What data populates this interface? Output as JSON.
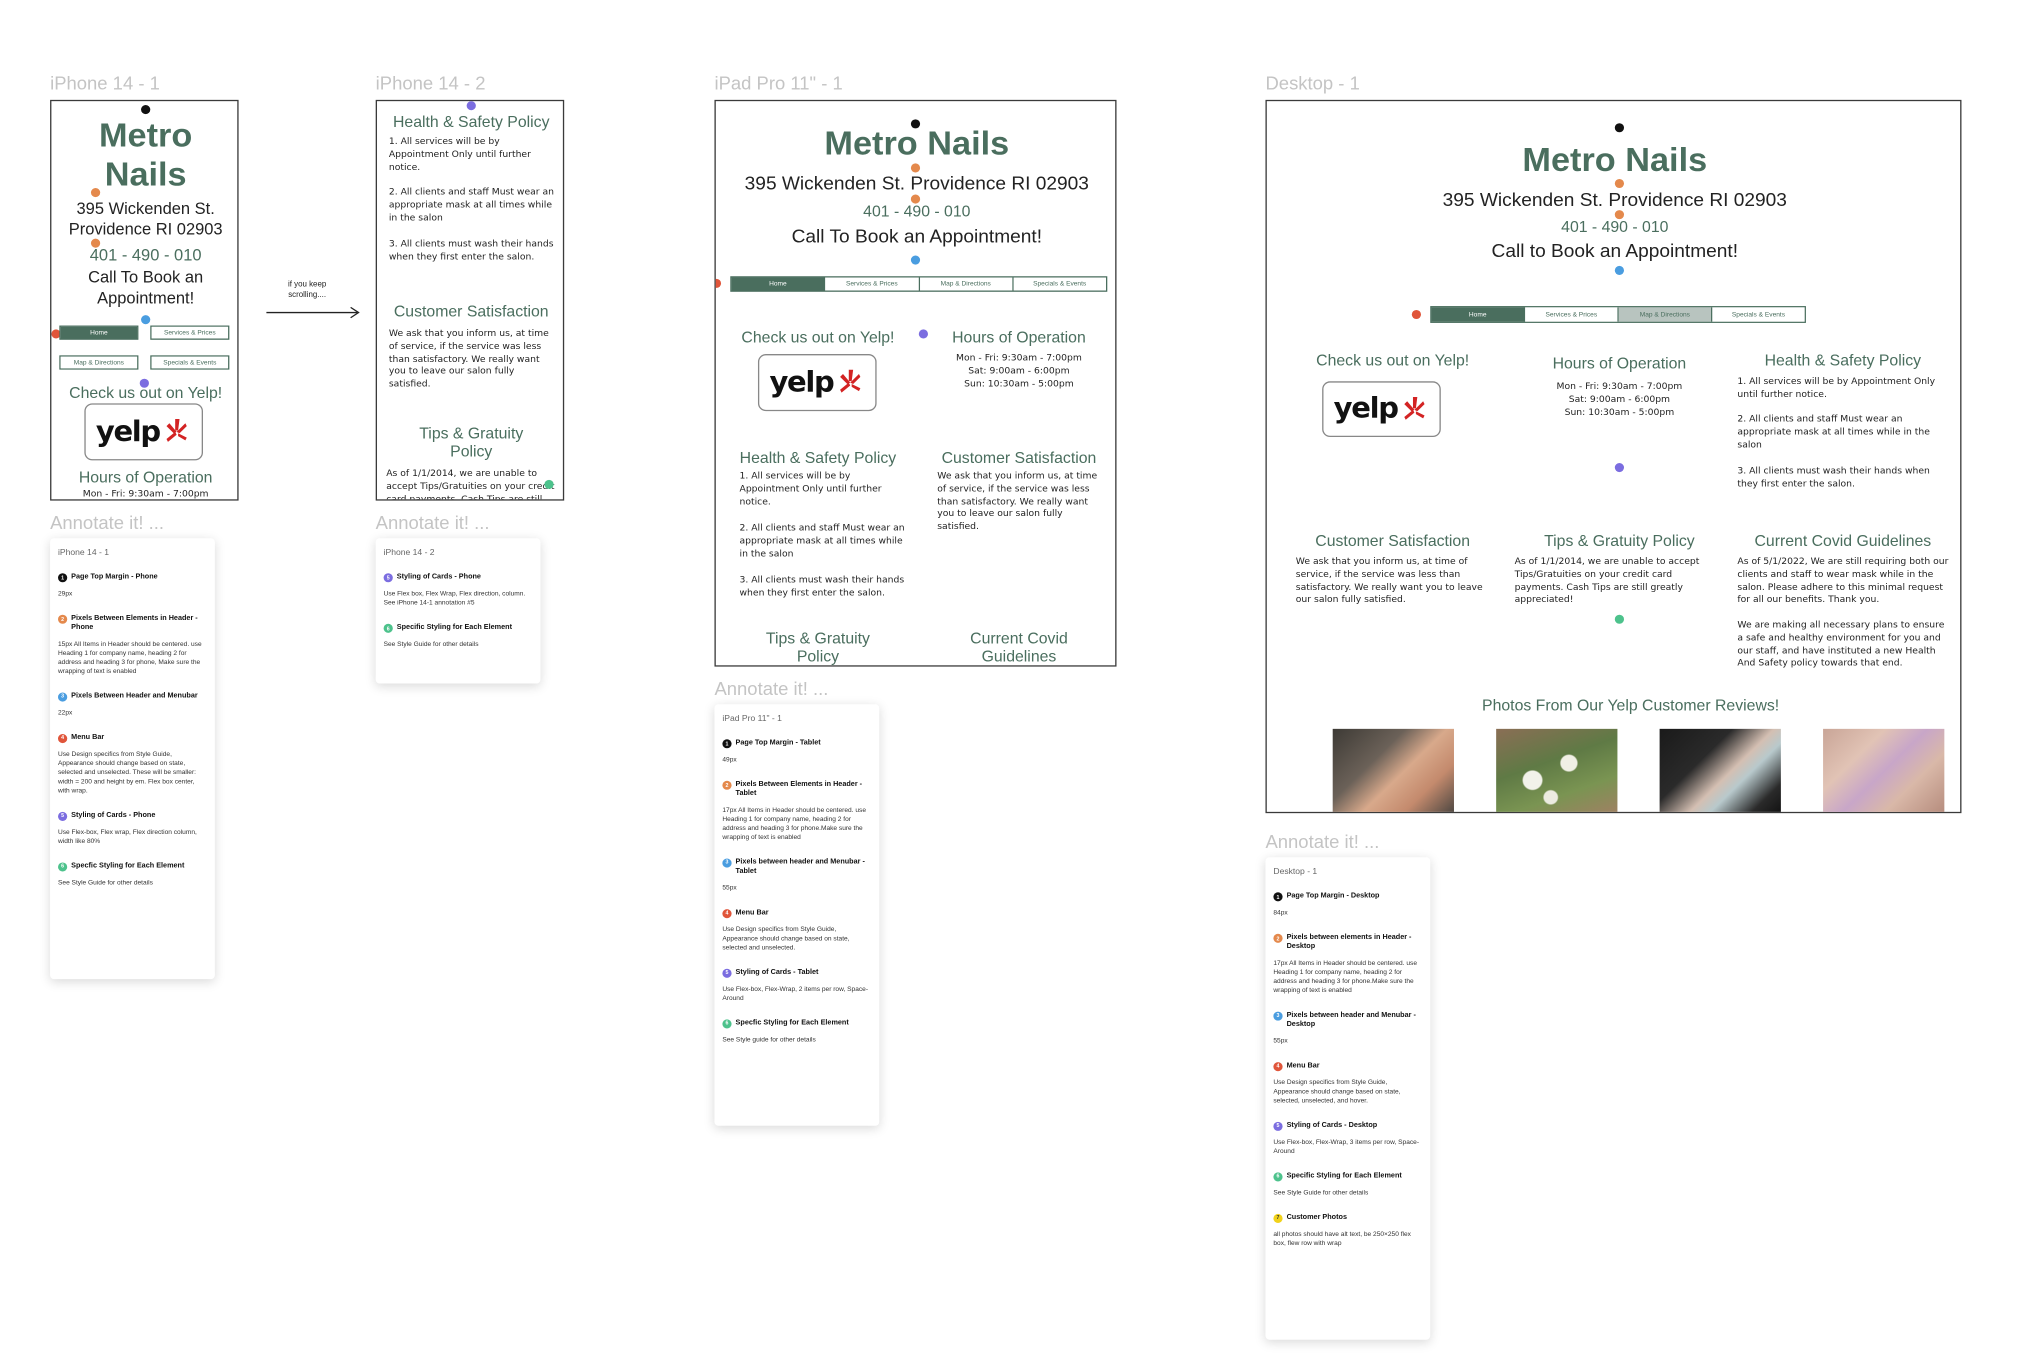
{
  "frames": {
    "iphone1": "iPhone 14 - 1",
    "iphone2": "iPhone 14 - 2",
    "ipad": "iPad Pro 11\" - 1",
    "desktop": "Desktop - 1"
  },
  "annotate_label": "Annotate it! ...",
  "site": {
    "name_line1": "Metro",
    "name_line2": "Nails",
    "name": "Metro Nails",
    "address": "395 Wickenden St. Providence RI 02903",
    "address_line1": "395 Wickenden St.",
    "address_line2": "Providence RI 02903",
    "phone": "401 - 490 - 010",
    "cta_upper": "Call To Book an Appointment!",
    "cta_lower": "Call to Book an Appointment!",
    "cta_line1": "Call To Book an",
    "cta_line2": "Appointment!",
    "menu": [
      "Home",
      "Services & Prices",
      "Map & Directions",
      "Specials & Events"
    ],
    "yelp_title": "Check us out on Yelp!",
    "yelp_word": "yelp",
    "hours_title": "Hours of Operation",
    "hours": [
      "Mon - Fri:   9:30am - 7:00pm",
      "Sat:   9:00am - 6:00pm",
      "Sun:  10:30am - 5:00pm"
    ],
    "hs_title": "Health & Safety Policy",
    "hs_items": [
      "1.  All services will be by Appointment Only until further notice.",
      "2.  All clients and staff Must wear an appropriate mask at all times while in the salon",
      "3.  All clients must wash their hands  when they first enter the salon."
    ],
    "cs_title": "Customer Satisfaction",
    "cs_text": "We ask that you  inform us, at time of service, if the service was less than satisfactory. We really want you to leave our salon fully satisfied.",
    "tips_title": "Tips & Gratuity Policy",
    "tips_text": "As of 1/1/2014, we are unable to accept Tips/Gratuities on your credit card payments.  Cash Tips are still greatly appreciated!",
    "covid_title": "Current Covid Guidelines",
    "covid_text1": "As of 5/1/2022, We are still requiring both our clients and staff to wear mask while in the salon. Please adhere to this minimal request for all our benefits. Thank you.",
    "covid_text2": "We are making all necessary plans to ensure a safe and healthy environment for you and our staff, and have instituted a new Health And Safety policy towards that end.",
    "photos_title": "Photos From Our Yelp Customer Reviews!"
  },
  "scroll_note": "if you keep scrolling....",
  "panels": {
    "iphone1": {
      "title": "iPhone 14 - 1",
      "items": [
        {
          "n": "1",
          "h": "Page Top Margin - Phone",
          "b": "29px"
        },
        {
          "n": "2",
          "h": "Pixels Between Elements in Header - Phone",
          "b": "15px All Items in Header should be centered. use Heading 1 for company name, heading 2 for address and heading 3 for phone, Make sure the wrapping of text is enabled"
        },
        {
          "n": "3",
          "h": "Pixels Between Header and Menubar",
          "b": "22px"
        },
        {
          "n": "4",
          "h": "Menu Bar",
          "b": "Use Design specifics from Style Guide, Appearance should change based on state, selected and unselected. These will be smaller: width = 200 and height by em. Flex box center, with wrap."
        },
        {
          "n": "5",
          "h": "Styling of Cards - Phone",
          "b": "Use Flex-box, Flex wrap, Flex direction column, width like 80%"
        },
        {
          "n": "6",
          "h": "Specfic Styling for Each Element",
          "b": "See Style Guide for other details"
        }
      ]
    },
    "iphone2": {
      "title": "iPhone 14 - 2",
      "items": [
        {
          "n": "5",
          "h": "Styling of Cards - Phone",
          "b": "Use Flex box, Flex Wrap, Flex direction, column. See iPhone 14-1 annotation #5"
        },
        {
          "n": "6",
          "h": "Specific Styling for Each Element",
          "b": "See Style Guide for other details"
        }
      ]
    },
    "ipad": {
      "title": "iPad Pro 11\" - 1",
      "items": [
        {
          "n": "1",
          "h": "Page Top Margin - Tablet",
          "b": "49px"
        },
        {
          "n": "2",
          "h": "Pixels Between Elements in Header - Tablet",
          "b": "17px All Items in Header should be centered. use Heading 1 for company name, heading 2 for address and heading 3 for phone.Make sure the wrapping of text is enabled"
        },
        {
          "n": "3",
          "h": "Pixels between header and Menubar - Tablet",
          "b": "55px"
        },
        {
          "n": "4",
          "h": "Menu Bar",
          "b": "Use Design specifics from Style Guide, Appearance should change based on state, selected and unselected."
        },
        {
          "n": "5",
          "h": "Styling of Cards - Tablet",
          "b": "Use Flex-box, Flex-Wrap, 2 items per row, Space-Around"
        },
        {
          "n": "6",
          "h": "Specfic Styling for Each Element",
          "b": "See Style guide for other details"
        }
      ]
    },
    "desktop": {
      "title": "Desktop - 1",
      "items": [
        {
          "n": "1",
          "h": "Page Top Margin - Desktop",
          "b": "84px"
        },
        {
          "n": "2",
          "h": "Pixels between elements in Header - Desktop",
          "b": "17px All Items in Header should be centered. use Heading 1 for company name, heading 2 for address and heading 3 for phone.Make sure the wrapping of text is enabled"
        },
        {
          "n": "3",
          "h": "Pixels between header and Menubar - Desktop",
          "b": "55px"
        },
        {
          "n": "4",
          "h": "Menu Bar",
          "b": "Use Design specifics from Style Guide, Appearance should change based on state, selected, unselected, and hover."
        },
        {
          "n": "5",
          "h": "Styling of Cards - Desktop",
          "b": "Use Flex-box, Flex-Wrap, 3 items per row, Space-Around"
        },
        {
          "n": "6",
          "h": "Specific Styling for Each Element",
          "b": "See Style Guide for other details"
        },
        {
          "n": "7",
          "h": "Customer Photos",
          "b": "all photos should have alt text, be 250×250 flex box, flew row with wrap"
        }
      ]
    }
  },
  "colors": {
    "brand": "#4a6e5e",
    "menu_selected": "#4a6e5e",
    "menu_hover": "#b8c4bf",
    "yelp_red": "#d32323"
  }
}
